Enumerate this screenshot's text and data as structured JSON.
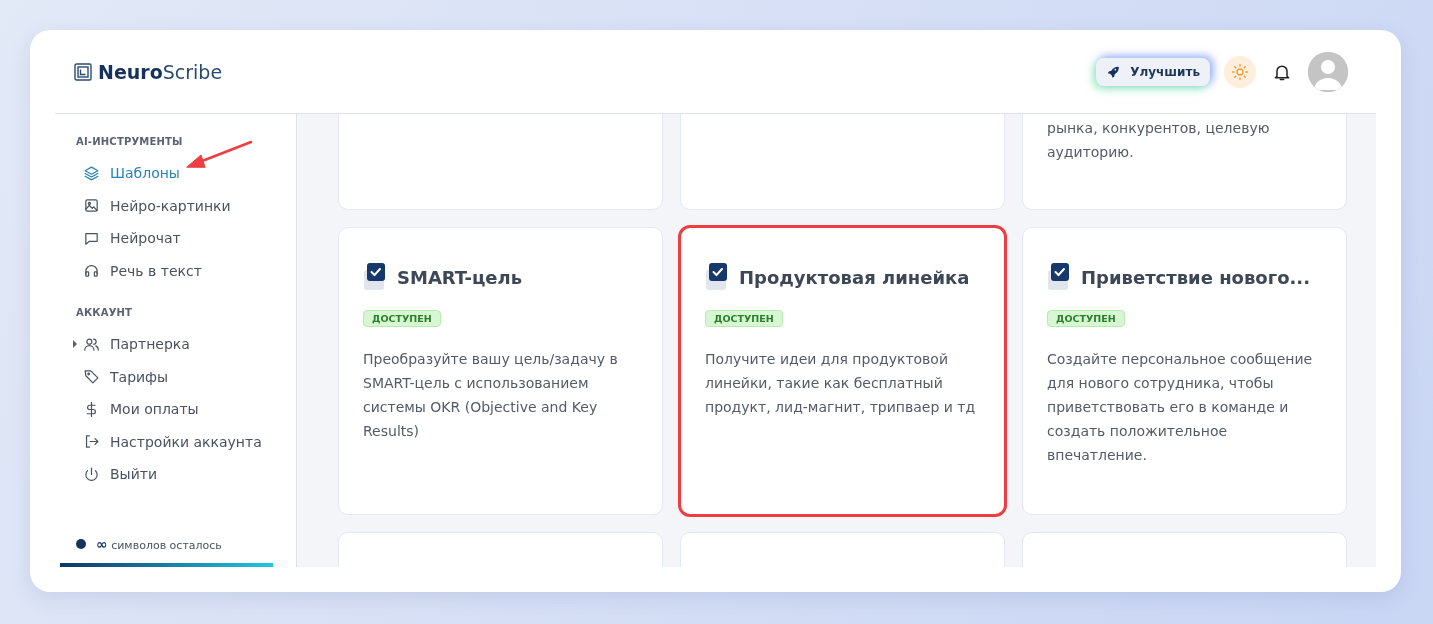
{
  "logo": {
    "bold": "Neuro",
    "light": "Scribe"
  },
  "header": {
    "upgrade_button": "Улучшить"
  },
  "sidebar": {
    "sections": [
      {
        "heading": "AI-ИНСТРУМЕНТЫ",
        "items": [
          {
            "label": "Шаблоны",
            "selected": true,
            "marked": true,
            "expandable": false
          },
          {
            "label": "Нейро-картинки",
            "selected": false,
            "marked": false,
            "expandable": false
          },
          {
            "label": "Нейрочат",
            "selected": false,
            "marked": false,
            "expandable": false
          },
          {
            "label": "Речь в текст",
            "selected": false,
            "marked": false,
            "expandable": false
          }
        ]
      },
      {
        "heading": "АККАУНТ",
        "items": [
          {
            "label": "Партнерка",
            "selected": false,
            "marked": false,
            "expandable": true
          },
          {
            "label": "Тарифы",
            "selected": false,
            "marked": false,
            "expandable": false
          },
          {
            "label": "Мои оплаты",
            "selected": false,
            "marked": false,
            "expandable": false
          },
          {
            "label": "Настройки аккаунта",
            "selected": false,
            "marked": false,
            "expandable": false
          },
          {
            "label": "Выйти",
            "selected": false,
            "marked": false,
            "expandable": false
          }
        ]
      }
    ],
    "quota": {
      "symbol": "∞",
      "text": "символов осталось",
      "level": 1
    }
  },
  "card_rows": [
    {
      "cards": [
        {
          "kind": "tail"
        },
        {
          "kind": "tail"
        },
        {
          "kind": "tail",
          "description": "рынка, конкурентов, целевую аудиторию."
        }
      ]
    },
    {
      "cards": [
        {
          "kind": "full",
          "title": "SMART-цель",
          "badge": "ДОСТУПЕН",
          "description": "Преобразуйте вашу цель/задачу в SMART-цель с использованием системы OKR (Objective and Key Results)",
          "highlighted": false
        },
        {
          "kind": "full",
          "title": "Продуктовая линейка",
          "badge": "ДОСТУПЕН",
          "description": "Получите идеи для продуктовой линейки, такие как бесплатный продукт, лид-магнит, трипваер и тд",
          "highlighted": true
        },
        {
          "kind": "full",
          "title": "Приветствие нового...",
          "badge": "ДОСТУПЕН",
          "description": "Создайте персональное сообщение для нового сотрудника, чтобы приветствовать его в команде и создать положительное впечатление.",
          "highlighted": false
        }
      ]
    },
    {
      "cards": [
        {
          "kind": "stub"
        },
        {
          "kind": "stub"
        },
        {
          "kind": "stub"
        }
      ]
    }
  ]
}
